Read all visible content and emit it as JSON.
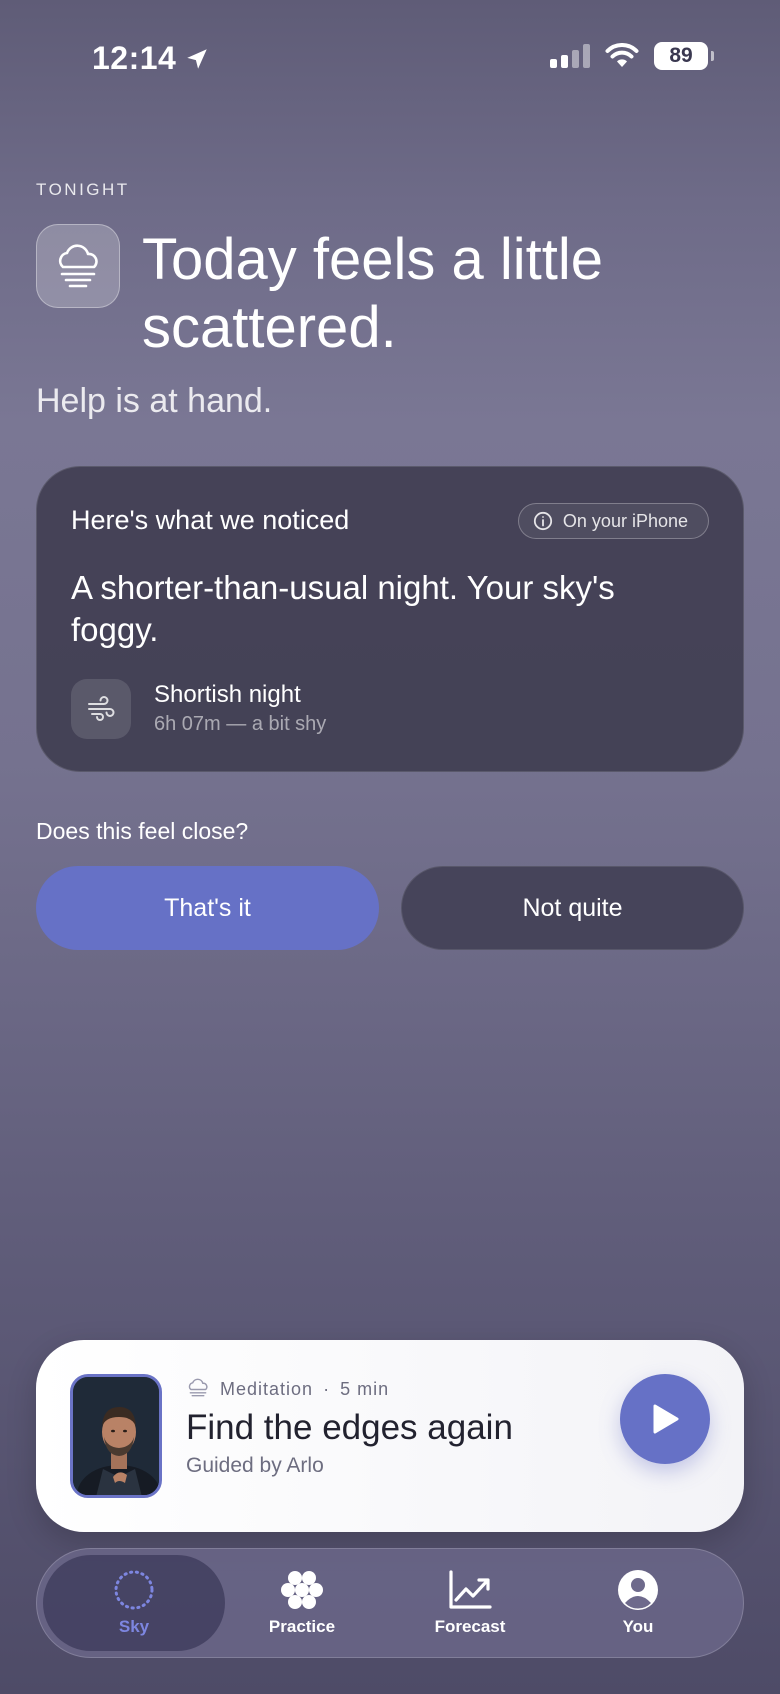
{
  "status_bar": {
    "time": "12:14",
    "battery": "89"
  },
  "header": {
    "eyebrow": "TONIGHT",
    "weather_icon": "cloud-fog-icon",
    "headline": "Today feels a little scattered.",
    "subhead": "Help is at hand."
  },
  "notice_card": {
    "title": "Here's what we noticed",
    "device_label": "On your iPhone",
    "body": "A shorter-than-usual night. Your sky's foggy.",
    "metric": {
      "icon": "wind-icon",
      "label": "Shortish night",
      "detail": "6h 07m — a bit shy"
    }
  },
  "feedback": {
    "question": "Does this feel close?",
    "confirm_label": "That's it",
    "reject_label": "Not quite"
  },
  "player": {
    "category": "Meditation",
    "separator": "·",
    "duration": "5 min",
    "title": "Find the edges again",
    "guide": "Guided by Arlo"
  },
  "tabs": [
    {
      "label": "Sky",
      "icon": "sky-ring-icon",
      "active": true
    },
    {
      "label": "Practice",
      "icon": "flower-icon",
      "active": false
    },
    {
      "label": "Forecast",
      "icon": "chart-up-icon",
      "active": false
    },
    {
      "label": "You",
      "icon": "profile-icon",
      "active": false
    }
  ],
  "colors": {
    "accent": "#6671c6",
    "active_tab": "#7d86e0"
  }
}
